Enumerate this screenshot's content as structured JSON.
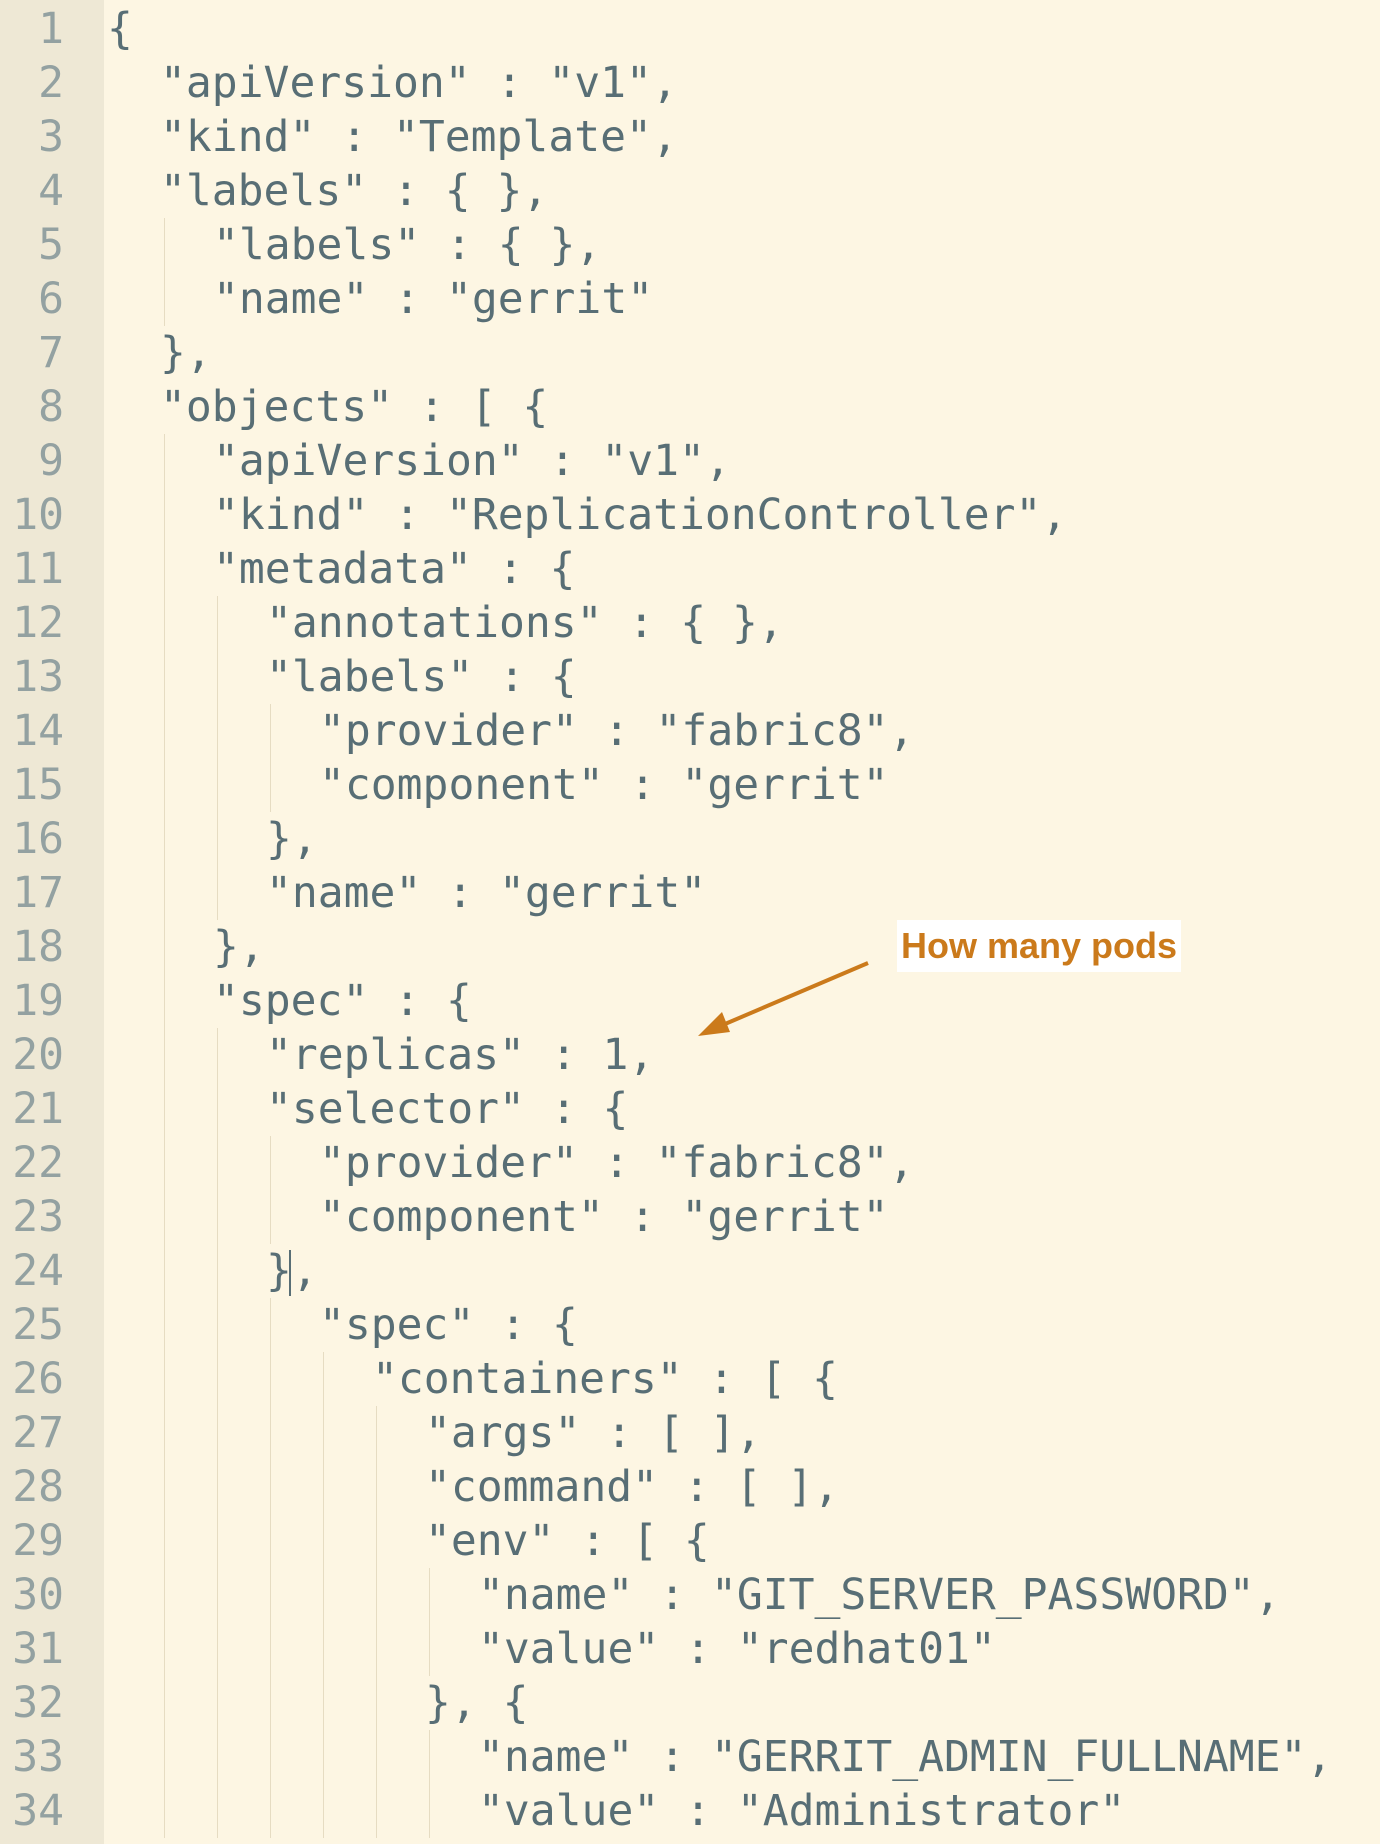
{
  "editor": {
    "lines": [
      {
        "n": "1",
        "indent": 0,
        "text": "{"
      },
      {
        "n": "2",
        "indent": 2,
        "text": "\"apiVersion\" : \"v1\","
      },
      {
        "n": "3",
        "indent": 2,
        "text": "\"kind\" : \"Template\","
      },
      {
        "n": "4",
        "indent": 2,
        "text": "\"labels\" : { },"
      },
      {
        "n": "5",
        "indent": 4,
        "text": "\"labels\" : { },"
      },
      {
        "n": "6",
        "indent": 4,
        "text": "\"name\" : \"gerrit\""
      },
      {
        "n": "7",
        "indent": 2,
        "text": "},"
      },
      {
        "n": "8",
        "indent": 2,
        "text": "\"objects\" : [ {"
      },
      {
        "n": "9",
        "indent": 4,
        "text": "\"apiVersion\" : \"v1\","
      },
      {
        "n": "10",
        "indent": 4,
        "text": "\"kind\" : \"ReplicationController\","
      },
      {
        "n": "11",
        "indent": 4,
        "text": "\"metadata\" : {"
      },
      {
        "n": "12",
        "indent": 6,
        "text": "\"annotations\" : { },"
      },
      {
        "n": "13",
        "indent": 6,
        "text": "\"labels\" : {"
      },
      {
        "n": "14",
        "indent": 8,
        "text": "\"provider\" : \"fabric8\","
      },
      {
        "n": "15",
        "indent": 8,
        "text": "\"component\" : \"gerrit\""
      },
      {
        "n": "16",
        "indent": 6,
        "text": "},"
      },
      {
        "n": "17",
        "indent": 6,
        "text": "\"name\" : \"gerrit\""
      },
      {
        "n": "18",
        "indent": 4,
        "text": "},"
      },
      {
        "n": "19",
        "indent": 4,
        "text": "\"spec\" : {"
      },
      {
        "n": "20",
        "indent": 6,
        "text": "\"replicas\" : 1,"
      },
      {
        "n": "21",
        "indent": 6,
        "text": "\"selector\" : {"
      },
      {
        "n": "22",
        "indent": 8,
        "text": "\"provider\" : \"fabric8\","
      },
      {
        "n": "23",
        "indent": 8,
        "text": "\"component\" : \"gerrit\""
      },
      {
        "n": "24",
        "indent": 6,
        "text": "},"
      },
      {
        "n": "25",
        "indent": 8,
        "text": "\"spec\" : {"
      },
      {
        "n": "26",
        "indent": 10,
        "text": "\"containers\" : [ {"
      },
      {
        "n": "27",
        "indent": 12,
        "text": "\"args\" : [ ],"
      },
      {
        "n": "28",
        "indent": 12,
        "text": "\"command\" : [ ],"
      },
      {
        "n": "29",
        "indent": 12,
        "text": "\"env\" : [ {"
      },
      {
        "n": "30",
        "indent": 14,
        "text": "\"name\" : \"GIT_SERVER_PASSWORD\","
      },
      {
        "n": "31",
        "indent": 14,
        "text": "\"value\" : \"redhat01\""
      },
      {
        "n": "32",
        "indent": 12,
        "text": "}, {"
      },
      {
        "n": "33",
        "indent": 14,
        "text": "\"name\" : \"GERRIT_ADMIN_FULLNAME\","
      },
      {
        "n": "34",
        "indent": 14,
        "text": "\"value\" : \"Administrator\""
      }
    ]
  },
  "annotation": {
    "label": "How many pods",
    "color": "#cb7a1b"
  },
  "theme": {
    "background": "#fdf6e3",
    "gutter": "#eee8d5",
    "text": "#586e75",
    "line_number": "#93a1a1"
  }
}
